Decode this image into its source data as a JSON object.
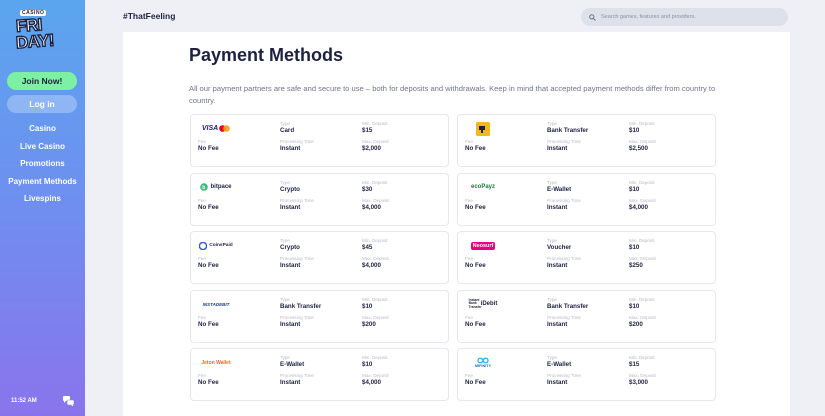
{
  "brand": {
    "small": "CASINO",
    "line1": "FRI",
    "line2": "DAY!"
  },
  "sidebar": {
    "join_label": "Join Now!",
    "login_label": "Log in",
    "items": [
      "Casino",
      "Live Casino",
      "Promotions",
      "Payment Methods",
      "Livespins"
    ],
    "time": "11:52 AM"
  },
  "header": {
    "hashtag": "#ThatFeeling",
    "search_placeholder": "Search games, features and providers."
  },
  "page": {
    "title": "Payment Methods",
    "intro": "All our payment partners are safe and secure to use – both for deposits and withdrawals. Keep in mind that accepted payment methods differ from country to country."
  },
  "labels": {
    "type": "Type",
    "min_deposit": "Min. Deposit",
    "fee": "Fee",
    "processing_time": "Processing Time",
    "max_deposit": "Max. Deposit"
  },
  "methods": [
    {
      "logo": "VISA",
      "type": "Card",
      "min": "$15",
      "fee": "No Fee",
      "time": "Instant",
      "max": "$2,000"
    },
    {
      "logo": "",
      "type": "Bank Transfer",
      "min": "$10",
      "fee": "No Fee",
      "time": "Instant",
      "max": "$2,500"
    },
    {
      "logo": "bitpace",
      "type": "Crypto",
      "min": "$30",
      "fee": "No Fee",
      "time": "Instant",
      "max": "$4,000"
    },
    {
      "logo": "ecoPayz",
      "type": "E-Wallet",
      "min": "$10",
      "fee": "No Fee",
      "time": "Instant",
      "max": "$4,000"
    },
    {
      "logo": "CoinsPaid",
      "type": "Crypto",
      "min": "$45",
      "fee": "No Fee",
      "time": "Instant",
      "max": "$4,000"
    },
    {
      "logo": "Neosurf",
      "type": "Voucher",
      "min": "$10",
      "fee": "No Fee",
      "time": "Instant",
      "max": "$250"
    },
    {
      "logo": "INSTADEBIT",
      "type": "Bank Transfer",
      "min": "$10",
      "fee": "No Fee",
      "time": "Instant",
      "max": "$200"
    },
    {
      "logo": "Instant Bank Transfer",
      "type": "Bank Transfer",
      "min": "$10",
      "fee": "No Fee",
      "time": "Instant",
      "max": "$200"
    },
    {
      "logo": "Jeton Wallet",
      "type": "E-Wallet",
      "min": "$10",
      "fee": "No Fee",
      "time": "Instant",
      "max": "$4,000"
    },
    {
      "logo": "MIFINITY",
      "type": "E-Wallet",
      "min": "$15",
      "fee": "No Fee",
      "time": "Instant",
      "max": "$3,000"
    }
  ],
  "colors": {
    "accent_green": "#7ef0a4",
    "sidebar_top": "#5aa6ee",
    "sidebar_bottom": "#8a74ec",
    "text_dark": "#1d2240"
  }
}
